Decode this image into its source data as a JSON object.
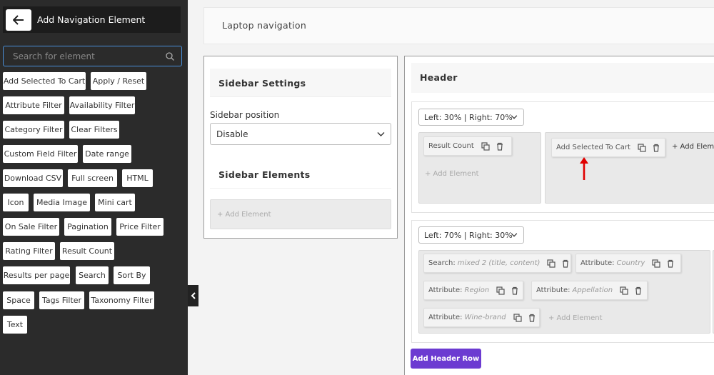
{
  "sidebar": {
    "title": "Add Navigation Element",
    "search_placeholder": "Search for element",
    "chips": [
      "Add Selected To Cart",
      "Apply / Reset",
      "Attribute Filter",
      "Availability Filter",
      "Category Filter",
      "Clear Filters",
      "Custom Field Filter",
      "Date range",
      "Download CSV",
      "Full screen",
      "HTML",
      "Icon",
      "Media Image",
      "Mini cart",
      "On Sale Filter",
      "Pagination",
      "Price Filter",
      "Rating Filter",
      "Result Count",
      "Results per page",
      "Search",
      "Sort By",
      "Space",
      "Tags Filter",
      "Taxonomy Filter",
      "Text"
    ]
  },
  "topbar": {
    "title": "Laptop navigation"
  },
  "sidebar_settings": {
    "title": "Sidebar Settings",
    "position_label": "Sidebar position",
    "position_value": "Disable",
    "elements_title": "Sidebar Elements",
    "add_element": "+ Add Element"
  },
  "header": {
    "title": "Header",
    "row1": {
      "layout": "Left: 30% | Right: 70%",
      "left_items": [
        "Result Count"
      ],
      "right_items": [
        "Add Selected To Cart"
      ],
      "add_element": "+ Add Element",
      "add_element_right": "+ Add Element"
    },
    "row2": {
      "layout": "Left: 70% | Right: 30%",
      "items": [
        {
          "label": "Search:",
          "value": "mixed 2 (title, content)"
        },
        {
          "label": "Attribute:",
          "value": "Country"
        },
        {
          "label": "Attribute:",
          "value": "Region"
        },
        {
          "label": "Attribute:",
          "value": "Appellation"
        },
        {
          "label": "Attribute:",
          "value": "Wine-brand"
        }
      ],
      "add_element": "+ Add Element"
    },
    "add_row_button": "Add Header Row"
  },
  "colors": {
    "accent": "#6c3bd1",
    "sidebar_bg": "#2b2b2b",
    "arrow": "#e00000"
  }
}
